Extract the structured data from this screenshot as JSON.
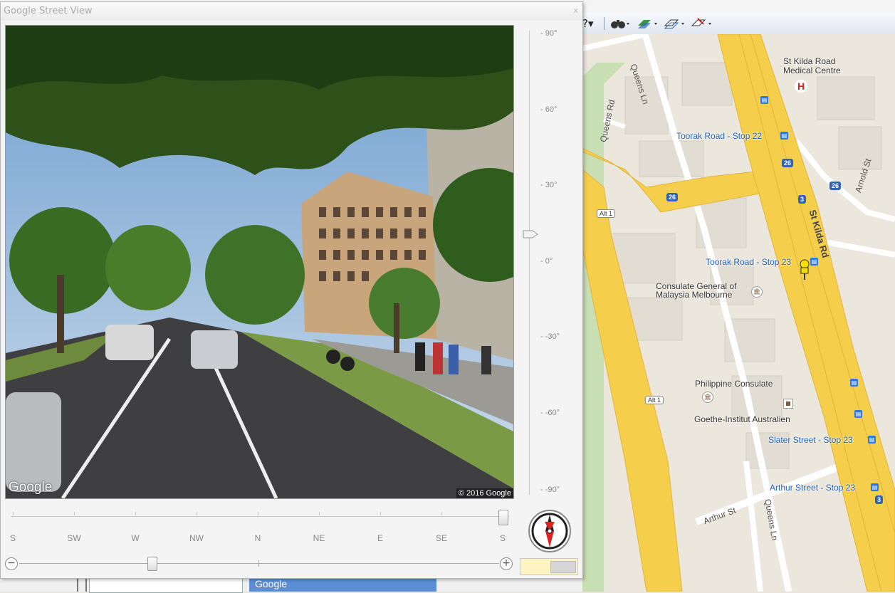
{
  "window": {
    "title": "Google Street View",
    "close_glyph": "x"
  },
  "photo": {
    "google_logo": "Google",
    "copyright": "© 2016 Google"
  },
  "pitch": {
    "labels": [
      "- 90°",
      "- 60°",
      "- 30°",
      "- 0°",
      "- -30°",
      "- -60°",
      "- -90°"
    ],
    "current_deg": 0
  },
  "heading": {
    "labels": [
      "S",
      "SW",
      "W",
      "NW",
      "N",
      "NE",
      "E",
      "SE",
      "S"
    ],
    "current": "S"
  },
  "zoom": {
    "minus": "⊖",
    "plus": "⊕"
  },
  "map": {
    "poi": {
      "hospital": "St Kilda Road\nMedical Centre",
      "consulate_malaysia": "Consulate General of\nMalaysia Melbourne",
      "consulate_philippine": "Philippine Consulate",
      "goethe": "Goethe-Institut Australien"
    },
    "transit": {
      "toorak_22": "Toorak Road - Stop 22",
      "toorak_23": "Toorak Road - Stop 23",
      "slater": "Slater Street - Stop 23",
      "arthur": "Arthur Street - Stop 23"
    },
    "streets": {
      "queens_ln_top": "Queens Ln",
      "queens_rd": "Queens Rd",
      "arnold": "Arnold St",
      "st_kilda": "St Kilda Rd",
      "arthur_st": "Arthur St",
      "queens_ln_bottom": "Queens Ln"
    },
    "shields": {
      "route_26_a": "26",
      "route_26_b": "26",
      "route_26_c": "26",
      "route_3_a": "3",
      "route_3_b": "3",
      "alt1_a": "Alt 1",
      "alt1_b": "Alt 1"
    },
    "hospital_glyph": "H",
    "google_bottom": "Google"
  },
  "toolbar": {
    "buttons": [
      "?▾",
      "🔭▾",
      "▾",
      "▾",
      "▾"
    ]
  },
  "colors": {
    "major_road": "#f5cf4b",
    "minor_road": "#ffffff",
    "map_land": "#ebe7dd",
    "park": "#c8dfb3",
    "transit_blue": "#2f7ad8"
  }
}
